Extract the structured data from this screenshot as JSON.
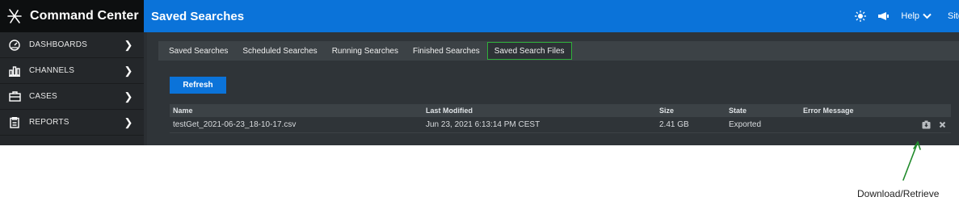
{
  "sidebar": {
    "brand": "Command Center",
    "items": [
      {
        "label": "DASHBOARDS",
        "icon": "dashboard-icon"
      },
      {
        "label": "CHANNELS",
        "icon": "bar-chart-icon"
      },
      {
        "label": "CASES",
        "icon": "briefcase-icon"
      },
      {
        "label": "REPORTS",
        "icon": "report-icon"
      }
    ]
  },
  "header": {
    "title": "Saved Searches",
    "help_label": "Help",
    "site_label": "Site"
  },
  "tabs": [
    {
      "label": "Saved Searches",
      "active": false
    },
    {
      "label": "Scheduled Searches",
      "active": false
    },
    {
      "label": "Running Searches",
      "active": false
    },
    {
      "label": "Finished Searches",
      "active": false
    },
    {
      "label": "Saved Search Files",
      "active": true
    }
  ],
  "refresh_label": "Refresh",
  "table": {
    "columns": {
      "name": "Name",
      "last_modified": "Last Modified",
      "size": "Size",
      "state": "State",
      "error": "Error Message"
    },
    "rows": [
      {
        "name": "testGet_2021-06-23_18-10-17.csv",
        "last_modified": "Jun 23, 2021 6:13:14 PM CEST",
        "size": "2.41 GB",
        "state": "Exported",
        "error": ""
      }
    ]
  },
  "annotation": {
    "label": "Download/Retrieve"
  },
  "colors": {
    "brand_blue": "#0b73d9",
    "active_tab_border": "#2fae3a",
    "annotation_green": "#1f8a2a"
  }
}
